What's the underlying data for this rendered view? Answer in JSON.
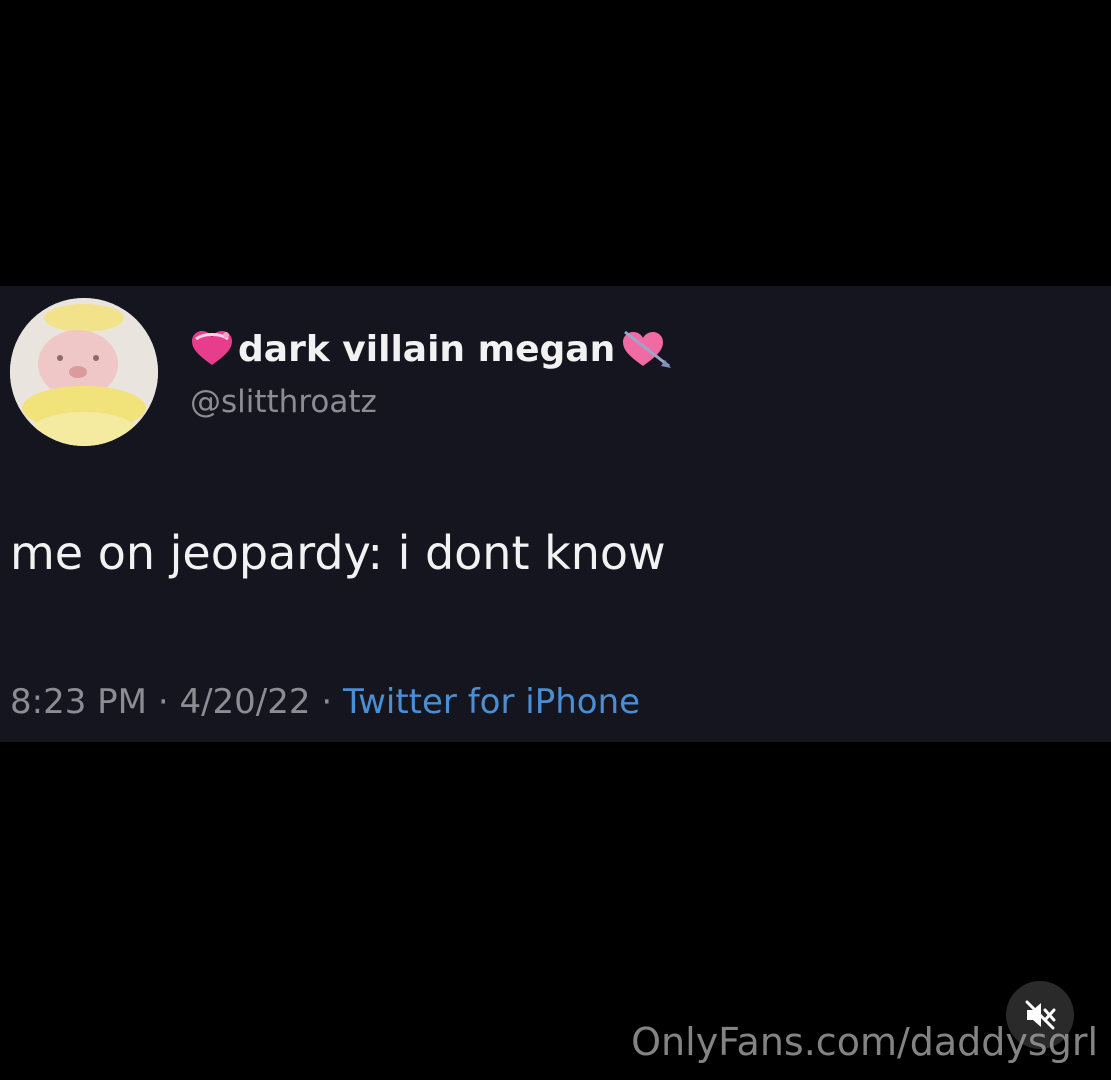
{
  "tweet": {
    "display_name": "dark villain megan",
    "handle": "@slitthroatz",
    "text": "me on jeopardy: i dont know",
    "time": "8:23 PM",
    "separator": "·",
    "date": "4/20/22",
    "source": "Twitter for iPhone",
    "name_prefix_emoji": "heart-with-ribbon-icon",
    "name_suffix_emoji": "heart-with-arrow-icon",
    "avatar_icon": "plush-toy-avatar"
  },
  "watermark": {
    "text": "OnlyFans.com/daddysgrl"
  },
  "video_controls": {
    "mute_icon": "speaker-muted-icon"
  },
  "colors": {
    "background": "#000000",
    "tweet_background": "#15151f",
    "primary_text": "#f2f2f2",
    "secondary_text": "#8a8d93",
    "link": "#4b8ed4"
  }
}
